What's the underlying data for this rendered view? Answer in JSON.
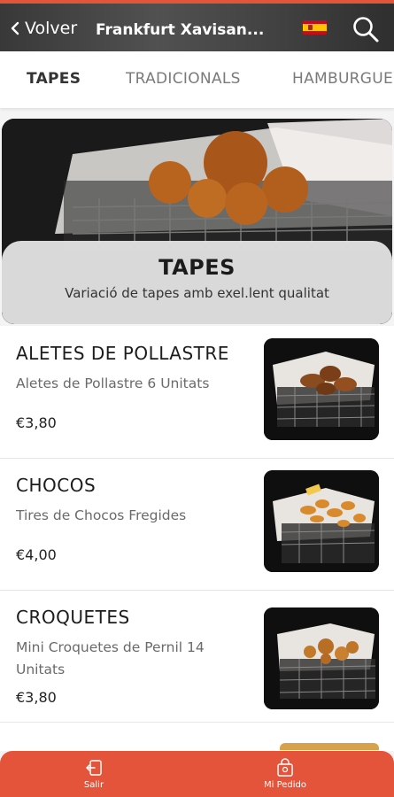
{
  "header": {
    "back_label": "Volver",
    "store_name": "Frankfurt Xavisan...",
    "language": "es"
  },
  "categories": [
    {
      "label": "TAPES",
      "active": true
    },
    {
      "label": "TRADICIONALS",
      "active": false
    },
    {
      "label": "HAMBURGUESES",
      "active": false
    }
  ],
  "hero": {
    "title": "TAPES",
    "subtitle": "Variació de tapes amb exel.lent qualitat"
  },
  "products": [
    {
      "name": "ALETES DE POLLASTRE",
      "description": "Aletes de Pollastre 6 Unitats",
      "price": "€3,80"
    },
    {
      "name": "CHOCOS",
      "description": "Tires de Chocos Fregides",
      "price": "€4,00"
    },
    {
      "name": "CROQUETES",
      "description": "Mini Croquetes de Pernil 14 Unitats",
      "price": "€3,80"
    }
  ],
  "bottom_nav": {
    "exit_label": "Salir",
    "order_label": "Mi Pedido"
  },
  "colors": {
    "accent": "#e4543a",
    "header_bg": "#2b2b2b",
    "text": "#1c1c1c",
    "muted": "#6a6a6a"
  }
}
